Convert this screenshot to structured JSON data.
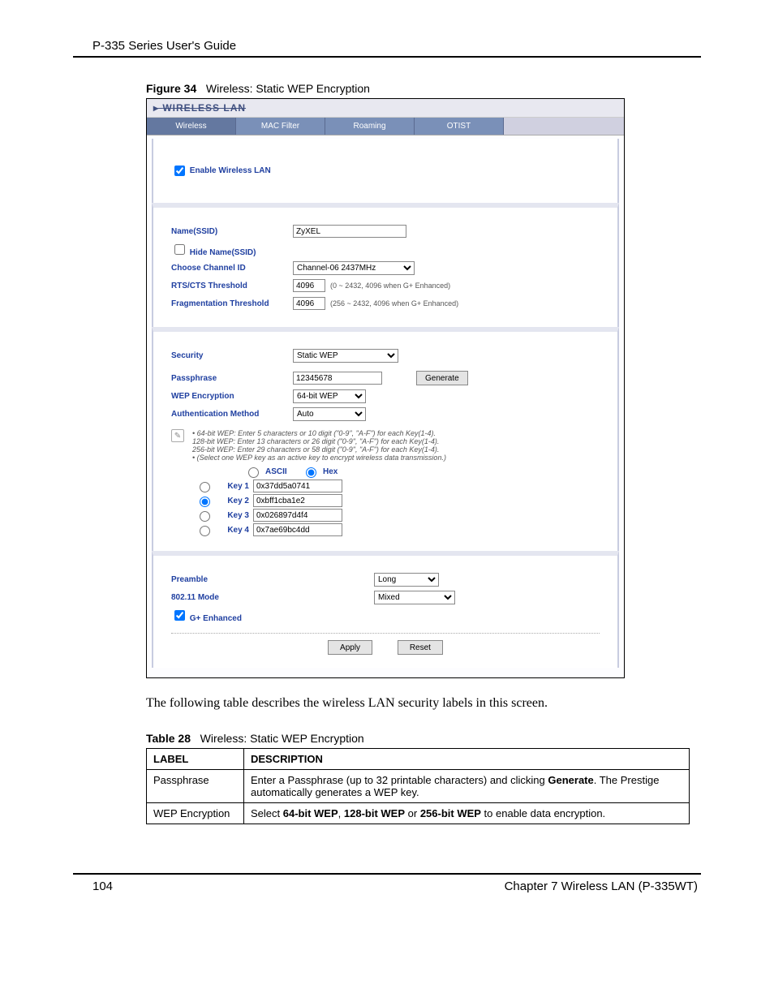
{
  "doc_header": "P-335 Series User's Guide",
  "figure": {
    "num": "Figure 34",
    "title": "Wireless: Static WEP Encryption"
  },
  "shot": {
    "title": "WIRELESS LAN",
    "tabs": [
      "Wireless",
      "MAC Filter",
      "Roaming",
      "OTIST"
    ],
    "enable_label": "Enable Wireless LAN",
    "enable_checked": true,
    "name_label": "Name(SSID)",
    "name_value": "ZyXEL",
    "hide_label": "Hide Name(SSID)",
    "hide_checked": false,
    "channel_label": "Choose Channel ID",
    "channel_value": "Channel-06 2437MHz",
    "rts_label": "RTS/CTS Threshold",
    "rts_value": "4096",
    "rts_hint": "(0 ~ 2432, 4096 when G+ Enhanced)",
    "frag_label": "Fragmentation Threshold",
    "frag_value": "4096",
    "frag_hint": "(256 ~ 2432, 4096 when G+ Enhanced)",
    "sec_label": "Security",
    "sec_value": "Static WEP",
    "pass_label": "Passphrase",
    "pass_value": "12345678",
    "generate_label": "Generate",
    "wep_label": "WEP Encryption",
    "wep_value": "64-bit WEP",
    "auth_label": "Authentication Method",
    "auth_value": "Auto",
    "note_lines": [
      "• 64-bit WEP: Enter 5 characters or 10 digit (\"0-9\", \"A-F\") for each Key(1-4).",
      "128-bit WEP: Enter 13 characters or 26 digit (\"0-9\", \"A-F\") for each Key(1-4).",
      "256-bit WEP: Enter 29 characters or 58 digit (\"0-9\", \"A-F\") for each Key(1-4).",
      "• (Select one WEP key as an active key to encrypt wireless data transmission.)"
    ],
    "ascii_label": "ASCII",
    "hex_label": "Hex",
    "keys": [
      {
        "label": "Key 1",
        "value": "0x37dd5a0741",
        "selected": false
      },
      {
        "label": "Key 2",
        "value": "0xbff1cba1e2",
        "selected": true
      },
      {
        "label": "Key 3",
        "value": "0x026897d4f4",
        "selected": false
      },
      {
        "label": "Key 4",
        "value": "0x7ae69bc4dd",
        "selected": false
      }
    ],
    "preamble_label": "Preamble",
    "preamble_value": "Long",
    "mode_label": "802.11 Mode",
    "mode_value": "Mixed",
    "gplus_label": "G+ Enhanced",
    "gplus_checked": true,
    "apply_label": "Apply",
    "reset_label": "Reset"
  },
  "body_text": "The following table describes the wireless LAN security labels in this screen.",
  "table": {
    "num": "Table 28",
    "title": "Wireless: Static WEP Encryption",
    "head_label": "LABEL",
    "head_desc": "DESCRIPTION",
    "rows": [
      {
        "label": "Passphrase",
        "desc_pre": "Enter a Passphrase (up to 32 printable characters) and clicking ",
        "desc_bold": "Generate",
        "desc_post": ". The Prestige automatically generates a WEP key."
      },
      {
        "label": "WEP Encryption",
        "desc_pre": "Select ",
        "desc_b1": "64-bit WEP",
        "desc_mid1": ", ",
        "desc_b2": "128-bit WEP",
        "desc_mid2": " or ",
        "desc_b3": "256-bit WEP",
        "desc_post": " to enable data encryption."
      }
    ]
  },
  "footer": {
    "page": "104",
    "chapter": "Chapter 7 Wireless LAN (P-335WT)"
  }
}
